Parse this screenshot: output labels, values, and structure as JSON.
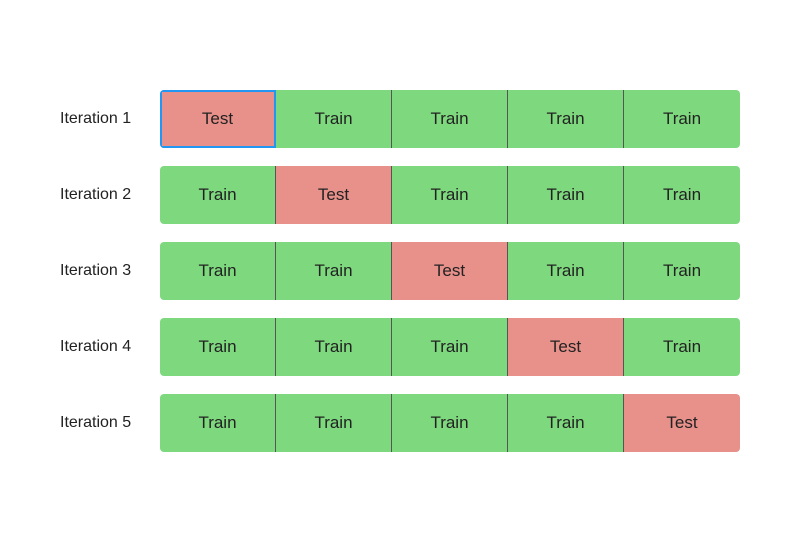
{
  "iterations": [
    {
      "label": "Iteration 1",
      "folds": [
        "test-highlighted",
        "train",
        "train",
        "train",
        "train"
      ]
    },
    {
      "label": "Iteration 2",
      "folds": [
        "train",
        "test",
        "train",
        "train",
        "train"
      ]
    },
    {
      "label": "Iteration 3",
      "folds": [
        "train",
        "train",
        "test",
        "train",
        "train"
      ]
    },
    {
      "label": "Iteration 4",
      "folds": [
        "train",
        "train",
        "train",
        "test",
        "train"
      ]
    },
    {
      "label": "Iteration 5",
      "folds": [
        "train",
        "train",
        "train",
        "train",
        "test"
      ]
    }
  ],
  "fold_labels": {
    "train": "Train",
    "test": "Test",
    "test-highlighted": "Test"
  }
}
